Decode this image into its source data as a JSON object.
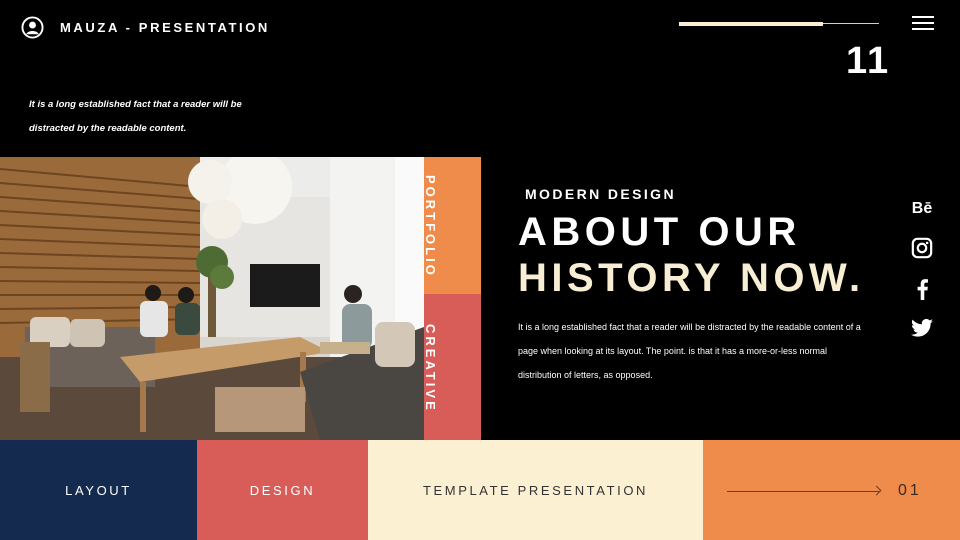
{
  "header": {
    "brand": "MAUZA - PRESENTATION",
    "page_number": "11",
    "progress_fraction": 0.72
  },
  "intro": {
    "line1": "It is a long established fact that a reader will be",
    "line2": "distracted by the readable content."
  },
  "side_labels": {
    "orange": "PORTFOLIO",
    "red": "CREATIVE"
  },
  "content": {
    "eyebrow": "MODERN DESIGN",
    "headline_line1": "ABOUT OUR",
    "headline_line2": "HISTORY NOW.",
    "body": "It is a long established fact that a reader will be distracted by the readable content of a page when looking at its layout. The point. is that it has a more-or-less normal distribution of letters, as opposed."
  },
  "social": {
    "behance": "Bē",
    "icons": [
      "behance-icon",
      "instagram-icon",
      "facebook-icon",
      "twitter-icon"
    ]
  },
  "footer": {
    "tiles": [
      "LAYOUT",
      "DESIGN",
      "TEMPLATE PRESENTATION"
    ],
    "next_number": "01"
  },
  "colors": {
    "background": "#000000",
    "cream": "#f8eed4",
    "navy": "#152a4f",
    "red": "#d85c58",
    "orange": "#ef8c4b",
    "light_cream": "#fbf0d2"
  }
}
